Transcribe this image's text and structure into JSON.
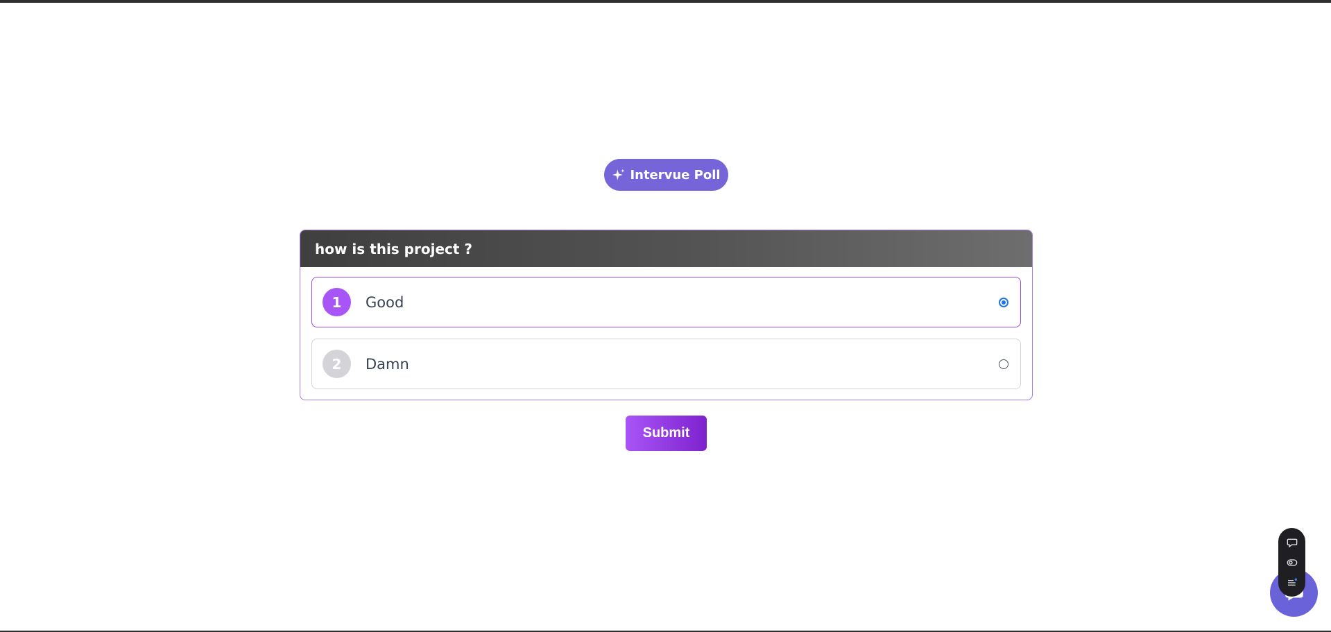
{
  "badge": {
    "label": "Intervue Poll",
    "icon": "sparkle-icon",
    "color": "#7565d9"
  },
  "poll": {
    "question": "how is this project ?",
    "options": [
      {
        "number": "1",
        "label": "Good",
        "selected": true
      },
      {
        "number": "2",
        "label": "Damn",
        "selected": false
      }
    ]
  },
  "actions": {
    "submit_label": "Submit"
  },
  "widget": {
    "icons": [
      "chat-bubble-icon",
      "eye-toggle-icon",
      "list-menu-icon"
    ],
    "fab_icon": "chat-icon",
    "fab_color": "#6a62d9"
  }
}
